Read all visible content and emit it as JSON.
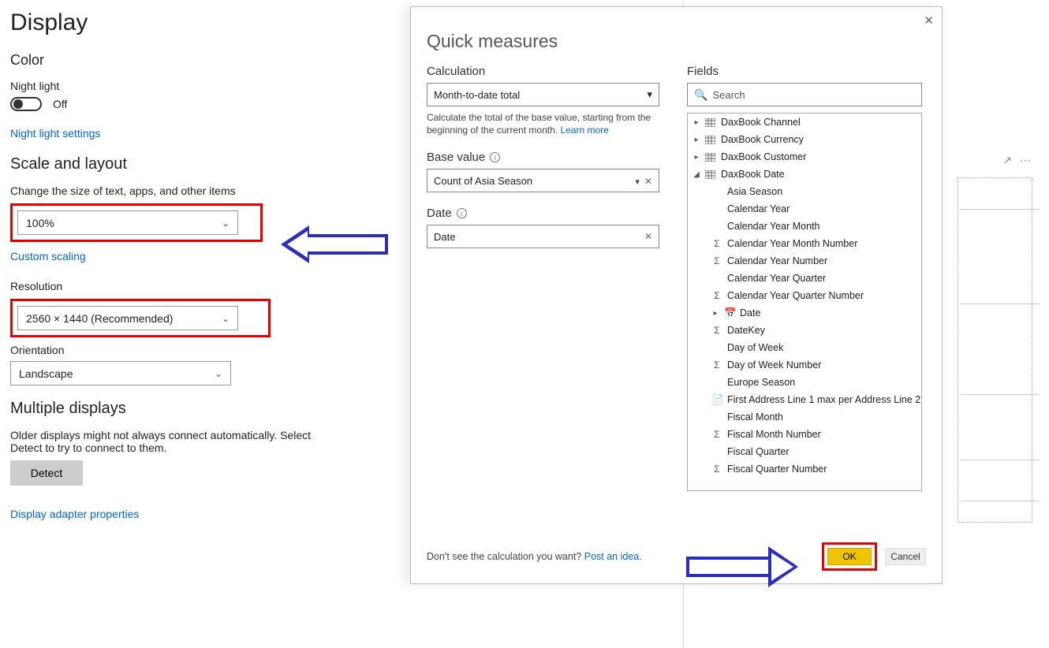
{
  "settings": {
    "title": "Display",
    "color_heading": "Color",
    "night_light_label": "Night light",
    "night_light_state": "Off",
    "night_light_settings_link": "Night light settings",
    "scale_heading": "Scale and layout",
    "scale_label": "Change the size of text, apps, and other items",
    "scale_value": "100%",
    "custom_scaling_link": "Custom scaling",
    "resolution_label": "Resolution",
    "resolution_value": "2560 × 1440 (Recommended)",
    "orientation_label": "Orientation",
    "orientation_value": "Landscape",
    "multi_heading": "Multiple displays",
    "multi_text": "Older displays might not always connect automatically. Select Detect to try to connect to them.",
    "detect_btn": "Detect",
    "adapter_link": "Display adapter properties"
  },
  "qm": {
    "title": "Quick measures",
    "calc_label": "Calculation",
    "calc_selected": "Month-to-date total",
    "calc_desc_a": "Calculate the total of the base value, starting from the beginning of the current month.  ",
    "learn_more": "Learn more",
    "base_label": "Base value",
    "base_value": "Count of Asia Season",
    "date_label": "Date",
    "date_value": "Date",
    "fields_label": "Fields",
    "search_placeholder": "Search",
    "tables": [
      {
        "name": "DaxBook Channel",
        "expanded": false
      },
      {
        "name": "DaxBook Currency",
        "expanded": false
      },
      {
        "name": "DaxBook Customer",
        "expanded": false
      }
    ],
    "date_table": {
      "name": "DaxBook Date",
      "fields": [
        {
          "name": "Asia Season",
          "type": "text"
        },
        {
          "name": "Calendar Year",
          "type": "text"
        },
        {
          "name": "Calendar Year Month",
          "type": "text"
        },
        {
          "name": "Calendar Year Month Number",
          "type": "sigma"
        },
        {
          "name": "Calendar Year Number",
          "type": "sigma"
        },
        {
          "name": "Calendar Year Quarter",
          "type": "text"
        },
        {
          "name": "Calendar Year Quarter Number",
          "type": "sigma"
        },
        {
          "name": "Date",
          "type": "expand"
        },
        {
          "name": "DateKey",
          "type": "sigma"
        },
        {
          "name": "Day of Week",
          "type": "text"
        },
        {
          "name": "Day of Week Number",
          "type": "sigma"
        },
        {
          "name": "Europe Season",
          "type": "text"
        },
        {
          "name": "First Address Line 1 max per Address Line 2",
          "type": "calc"
        },
        {
          "name": "Fiscal Month",
          "type": "text"
        },
        {
          "name": "Fiscal Month Number",
          "type": "sigma"
        },
        {
          "name": "Fiscal Quarter",
          "type": "text"
        },
        {
          "name": "Fiscal Quarter Number",
          "type": "sigma"
        }
      ]
    },
    "footer_prompt": "Don't see the calculation you want? ",
    "footer_idea": "Post an idea.",
    "ok": "OK",
    "cancel": "Cancel"
  }
}
